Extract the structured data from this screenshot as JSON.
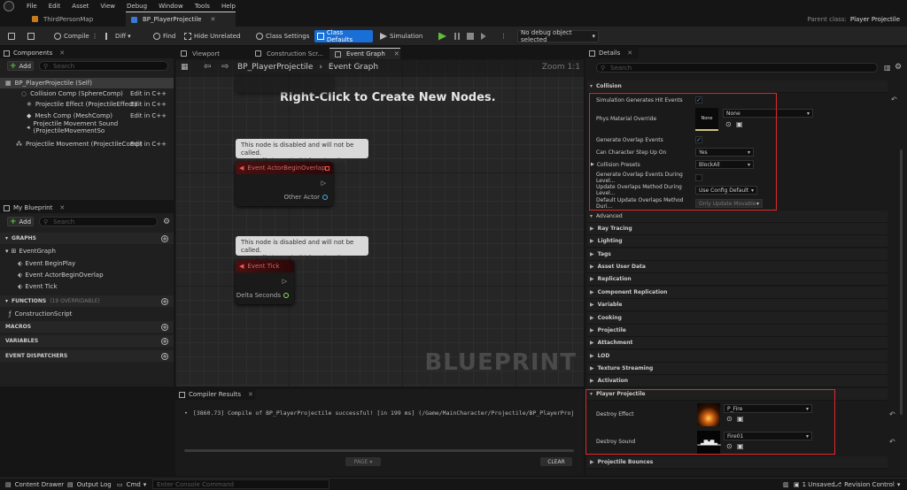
{
  "menu": [
    "File",
    "Edit",
    "Asset",
    "View",
    "Debug",
    "Window",
    "Tools",
    "Help"
  ],
  "tabs": [
    {
      "label": "ThirdPersonMap"
    },
    {
      "label": "BP_PlayerProjectile"
    }
  ],
  "parent_class": {
    "label": "Parent class:",
    "value": "Player Projectile"
  },
  "toolbar": {
    "compile": "Compile",
    "diff": "Diff",
    "find": "Find",
    "hide_unrelated": "Hide Unrelated",
    "class_settings": "Class Settings",
    "class_defaults": "Class Defaults",
    "simulation": "Simulation",
    "debug_object": "No debug object selected"
  },
  "components": {
    "title": "Components",
    "add": "Add",
    "search_placeholder": "Search",
    "root": "BP_PlayerProjectile (Self)",
    "items": [
      {
        "label": "Collision Comp (SphereComp)",
        "right": "Edit in C++"
      },
      {
        "label": "Projectile Effect (ProjectileEffect)",
        "right": "Edit in C++"
      },
      {
        "label": "Mesh Comp (MeshComp)",
        "right": "Edit in C++"
      },
      {
        "label": "Projectile Movement Sound (ProjectileMovementSo",
        "right": ""
      },
      {
        "label": "Projectile Movement (ProjectileComp)",
        "right": "Edit in C++"
      }
    ]
  },
  "my_blueprint": {
    "title": "My Blueprint",
    "add": "Add",
    "search_placeholder": "Search",
    "graphs_label": "GRAPHS",
    "event_graph": "EventGraph",
    "events": [
      "Event BeginPlay",
      "Event ActorBeginOverlap",
      "Event Tick"
    ],
    "functions_label": "FUNCTIONS",
    "functions_count": "(19 OVERRIDABLE)",
    "construction_script": "ConstructionScript",
    "macros_label": "MACROS",
    "variables_label": "VARIABLES",
    "dispatchers_label": "EVENT DISPATCHERS"
  },
  "graph": {
    "tabs": [
      "Viewport",
      "Construction Scr...",
      "Event Graph"
    ],
    "breadcrumb_root": "BP_PlayerProjectile",
    "breadcrumb_sep": "›",
    "breadcrumb_leaf": "Event Graph",
    "zoom": "Zoom 1:1",
    "hint": "Right-Click to Create New Nodes.",
    "watermark": "BLUEPRINT",
    "comment1": "This node is disabled and will not be called.\nDrag off pins to build functionality.",
    "node1_title": "Event ActorBeginOverlap",
    "node1_pin": "Other Actor",
    "comment2": "This node is disabled and will not be called.\nDrag off pins to build functionality.",
    "node2_title": "Event Tick",
    "node2_pin": "Delta Seconds"
  },
  "compiler": {
    "title": "Compiler Results",
    "message": "[3860.73] Compile of BP_PlayerProjectile successful! [in 199 ms] (/Game/MainCharacter/Projectile/BP_PlayerProjecti",
    "page": "PAGE",
    "clear": "CLEAR"
  },
  "details": {
    "title": "Details",
    "search_placeholder": "Search",
    "collision_label": "Collision",
    "collision_rows": [
      {
        "label": "Simulation Generates Hit Events",
        "kind": "check",
        "value": "✓"
      },
      {
        "label": "Phys Material Override",
        "kind": "asset",
        "value": "None",
        "thumb": "None"
      },
      {
        "label": "Generate Overlap Events",
        "kind": "check",
        "value": "✓"
      },
      {
        "label": "Can Character Step Up On",
        "kind": "combo",
        "value": "Yes"
      },
      {
        "label": "Collision Presets",
        "kind": "combo",
        "value": "BlockAll"
      },
      {
        "label": "Generate Overlap Events During Level...",
        "kind": "check",
        "value": ""
      },
      {
        "label": "Update Overlaps Method During Level...",
        "kind": "combo",
        "value": "Use Config Default"
      },
      {
        "label": "Default Update Overlaps Method Duri...",
        "kind": "combo",
        "value": "Only Update Movable"
      }
    ],
    "categories": [
      "Advanced",
      "Ray Tracing",
      "Lighting",
      "Tags",
      "Asset User Data",
      "Replication",
      "Component Replication",
      "Variable",
      "Cooking",
      "Projectile",
      "Attachment",
      "LOD",
      "Texture Streaming",
      "Activation"
    ],
    "player_projectile_label": "Player Projectile",
    "destroy_effect_label": "Destroy Effect",
    "destroy_effect_value": "P_Fire",
    "destroy_sound_label": "Destroy Sound",
    "destroy_sound_value": "Fire01",
    "last_category": "Projectile Bounces"
  },
  "status": {
    "content_drawer": "Content Drawer",
    "output_log": "Output Log",
    "cmd": "Cmd",
    "console_placeholder": "Enter Console Command",
    "unsaved": "1 Unsaved",
    "revision": "Revision Control"
  },
  "colors": {
    "accent": "#1a6fd6",
    "highlight": "#e02828",
    "check": "#4aa3ff",
    "play": "#5fbf3a"
  }
}
